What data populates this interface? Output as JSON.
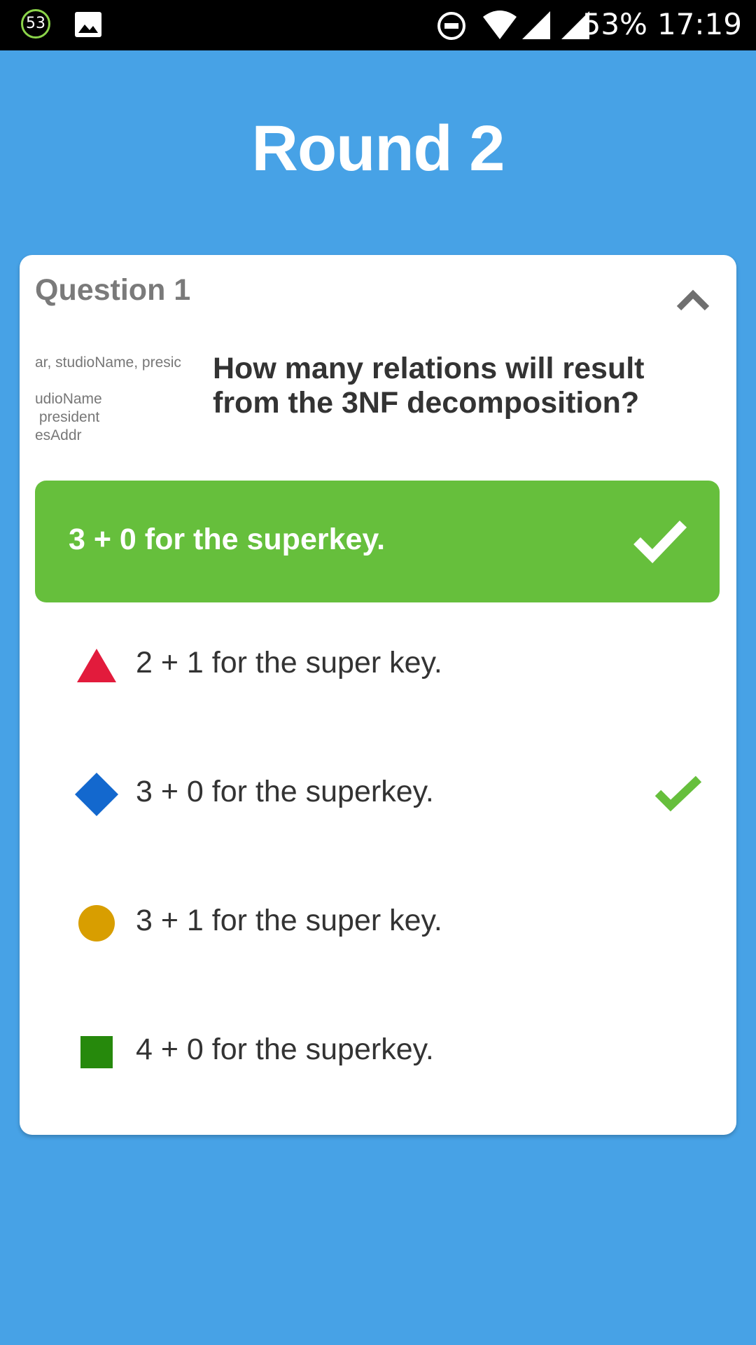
{
  "status_bar": {
    "notification_count": "53",
    "battery": "53%",
    "time": "17:19"
  },
  "title": "Round 2",
  "question": {
    "number_label": "Question 1",
    "text": "How many relations will result from the 3NF decomposition?",
    "thumbnail_lines": [
      "ar, studioName, presic",
      "udioName",
      " president",
      "esAddr"
    ]
  },
  "correct_answer": {
    "text": "3 + 0 for the superkey."
  },
  "answers": [
    {
      "shape": "triangle-icon",
      "color": "#e21b3c",
      "text": "2 + 1 for the super key.",
      "correct": false
    },
    {
      "shape": "diamond-icon",
      "color": "#1368ce",
      "text": "3 + 0 for the superkey.",
      "correct": true
    },
    {
      "shape": "circle-icon",
      "color": "#d89e00",
      "text": "3 + 1 for the super key.",
      "correct": false
    },
    {
      "shape": "square-icon",
      "color": "#26890c",
      "text": "4 + 0 for the superkey.",
      "correct": false
    }
  ],
  "colors": {
    "background": "#47a2e6",
    "correct_green": "#66bf3c"
  }
}
